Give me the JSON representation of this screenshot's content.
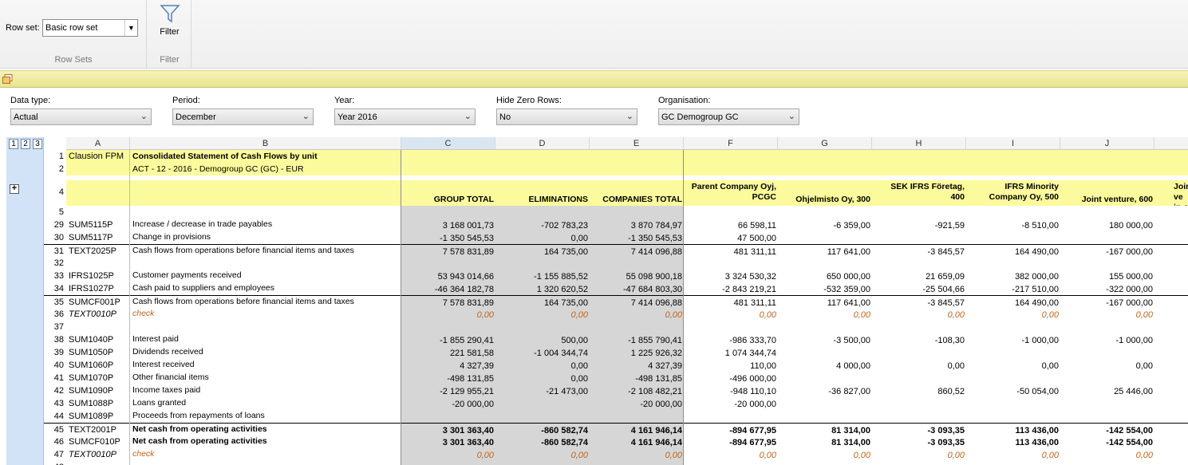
{
  "ribbon": {
    "rowset_label": "Row set:",
    "rowset_value": "Basic row set",
    "rowsets_caption": "Row Sets",
    "filter_button": "Filter",
    "filter_caption": "Filter"
  },
  "filters": [
    {
      "label": "Data type:",
      "value": "Actual"
    },
    {
      "label": "Period:",
      "value": "December"
    },
    {
      "label": "Year:",
      "value": "Year 2016"
    },
    {
      "label": "Hide Zero Rows:",
      "value": "No"
    },
    {
      "label": "Organisation:",
      "value": "GC Demogroup GC"
    }
  ],
  "outline_levels": [
    "1",
    "2",
    "3"
  ],
  "columns": [
    "A",
    "B",
    "C",
    "D",
    "E",
    "F",
    "G",
    "H",
    "I",
    "J"
  ],
  "report": {
    "company_label": "Clausion FPM",
    "title": "Consolidated Statement of Cash Flows by unit",
    "subtitle": "ACT - 12 - 2016 - Demogroup GC (GC) - EUR",
    "col_headers": {
      "C": "GROUP TOTAL",
      "D": "ELIMINATIONS",
      "E": "COMPANIES TOTAL",
      "F1": "Parent Company Oyj,",
      "F2": "PCGC",
      "G": "Ohjelmisto Oy, 300",
      "H1": "SEK IFRS Företag,",
      "H2": "400",
      "I1": "IFRS Minority",
      "I2": "Company Oy, 500",
      "J": "Joint venture, 600",
      "K1": "Joint ve",
      "K2": "in o"
    }
  },
  "rows": [
    {
      "n": "29",
      "code": "SUM5115P",
      "desc": "Increase / decrease in trade payables",
      "vals": [
        "3 168 001,73",
        "-702 783,23",
        "3 870 784,97",
        "66 598,11",
        "-6 359,00",
        "-921,59",
        "-8 510,00",
        "180 000,00"
      ]
    },
    {
      "n": "30",
      "code": "SUM5117P",
      "desc": "Change in provisions",
      "vals": [
        "-1 350 545,53",
        "0,00",
        "-1 350 545,53",
        "47 500,00",
        "",
        "",
        "",
        ""
      ]
    },
    {
      "n": "31",
      "code": "TEXT2025P",
      "desc": "Cash flows from operations before financial items and taxes",
      "vals": [
        "7 578 831,89",
        "164 735,00",
        "7 414 096,88",
        "481 311,11",
        "117 641,00",
        "-3 845,57",
        "164 490,00",
        "-167 000,00"
      ],
      "topline": true
    },
    {
      "n": "32",
      "code": "",
      "desc": "",
      "vals": [
        "",
        "",
        "",
        "",
        "",
        "",
        "",
        ""
      ]
    },
    {
      "n": "33",
      "code": "IFRS1025P",
      "desc": "Customer payments received",
      "vals": [
        "53 943 014,66",
        "-1 155 885,52",
        "55 098 900,18",
        "3 324 530,32",
        "650 000,00",
        "21 659,09",
        "382 000,00",
        "155 000,00"
      ]
    },
    {
      "n": "34",
      "code": "IFRS1027P",
      "desc": "Cash paid to suppliers and employees",
      "vals": [
        "-46 364 182,78",
        "1 320 620,52",
        "-47 684 803,30",
        "-2 843 219,21",
        "-532 359,00",
        "-25 504,66",
        "-217 510,00",
        "-322 000,00"
      ]
    },
    {
      "n": "35",
      "code": "SUMCF001P",
      "desc": "Cash flows from operations before financial items and taxes",
      "vals": [
        "7 578 831,89",
        "164 735,00",
        "7 414 096,88",
        "481 311,11",
        "117 641,00",
        "-3 845,57",
        "164 490,00",
        "-167 000,00"
      ],
      "topline": true
    },
    {
      "n": "36",
      "code": "TEXT0010P",
      "desc": "check",
      "vals": [
        "0,00",
        "0,00",
        "0,00",
        "0,00",
        "0,00",
        "0,00",
        "0,00",
        "0,00"
      ],
      "check": true
    },
    {
      "n": "37",
      "code": "",
      "desc": "",
      "vals": [
        "",
        "",
        "",
        "",
        "",
        "",
        "",
        ""
      ]
    },
    {
      "n": "38",
      "code": "SUM1040P",
      "desc": "Interest paid",
      "vals": [
        "-1 855 290,41",
        "500,00",
        "-1 855 790,41",
        "-986 333,70",
        "-3 500,00",
        "-108,30",
        "-1 000,00",
        "-1 000,00"
      ]
    },
    {
      "n": "39",
      "code": "SUM1050P",
      "desc": "Dividends received",
      "vals": [
        "221 581,58",
        "-1 004 344,74",
        "1 225 926,32",
        "1 074 344,74",
        "",
        "",
        "",
        ""
      ]
    },
    {
      "n": "40",
      "code": "SUM1060P",
      "desc": "Interest received",
      "vals": [
        "4 327,39",
        "0,00",
        "4 327,39",
        "110,00",
        "4 000,00",
        "0,00",
        "0,00",
        "0,00"
      ]
    },
    {
      "n": "41",
      "code": "SUM1070P",
      "desc": "Other financial items",
      "vals": [
        "-498 131,85",
        "0,00",
        "-498 131,85",
        "-496 000,00",
        "",
        "",
        "",
        ""
      ]
    },
    {
      "n": "42",
      "code": "SUM1090P",
      "desc": "Income taxes paid",
      "vals": [
        "-2 129 955,21",
        "-21 473,00",
        "-2 108 482,21",
        "-948 110,10",
        "-36 827,00",
        "860,52",
        "-50 054,00",
        "25 446,00"
      ]
    },
    {
      "n": "43",
      "code": "SUM1088P",
      "desc": "Loans granted",
      "vals": [
        "-20 000,00",
        "",
        "-20 000,00",
        "-20 000,00",
        "",
        "",
        "",
        ""
      ]
    },
    {
      "n": "44",
      "code": "SUM1089P",
      "desc": "Proceeds from repayments of loans",
      "vals": [
        "",
        "",
        "",
        "",
        "",
        "",
        "",
        ""
      ]
    },
    {
      "n": "45",
      "code": "TEXT2001P",
      "desc": "Net cash from operating activities",
      "vals": [
        "3 301 363,40",
        "-860 582,74",
        "4 161 946,14",
        "-894 677,95",
        "81 314,00",
        "-3 093,35",
        "113 436,00",
        "-142 554,00"
      ],
      "bold": true,
      "topline": true
    },
    {
      "n": "46",
      "code": "SUMCF010P",
      "desc": "Net cash from operating activities",
      "vals": [
        "3 301 363,40",
        "-860 582,74",
        "4 161 946,14",
        "-894 677,95",
        "81 314,00",
        "-3 093,35",
        "113 436,00",
        "-142 554,00"
      ],
      "bold": true
    },
    {
      "n": "47",
      "code": "TEXT0010P",
      "desc": "check",
      "vals": [
        "0,00",
        "0,00",
        "0,00",
        "0,00",
        "0,00",
        "0,00",
        "0,00",
        "0,00"
      ],
      "check": true
    },
    {
      "n": "48",
      "code": "",
      "desc": "",
      "vals": [
        "",
        "",
        "",
        "",
        "",
        "",
        "",
        ""
      ]
    }
  ]
}
